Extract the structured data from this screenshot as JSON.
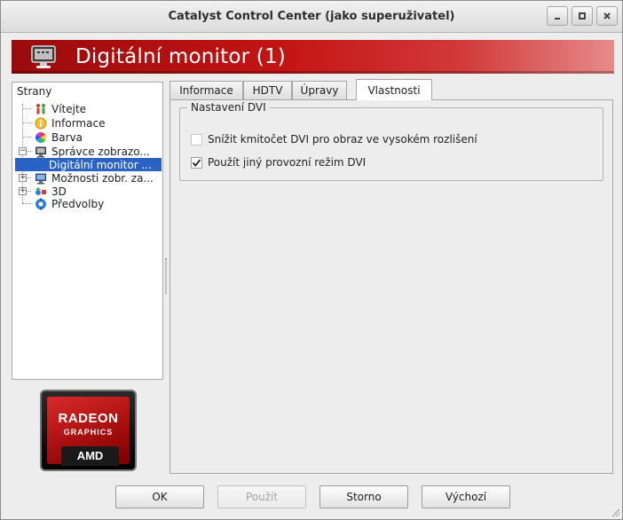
{
  "window": {
    "title": "Catalyst Control Center (jako superuživatel)",
    "controls": {
      "minimize_icon": "minimize-icon",
      "maximize_icon": "maximize-icon",
      "close_icon": "close-icon"
    }
  },
  "banner": {
    "title": "Digitální monitor (1)",
    "icon": "monitor-icon",
    "gradient_colors": [
      "#9a0b0b",
      "#c41414",
      "#e68a8a"
    ]
  },
  "sidebar": {
    "header": "Strany",
    "items": [
      {
        "label": "Vítejte",
        "icon": "welcome-icon"
      },
      {
        "label": "Informace",
        "icon": "info-icon"
      },
      {
        "label": "Barva",
        "icon": "color-wheel-icon"
      },
      {
        "label": "Správce zobrazo...",
        "icon": "display-manager-icon",
        "expanded": true
      },
      {
        "label": "Digitální monitor ...",
        "selected": true
      },
      {
        "label": "Možnosti zobr. za...",
        "icon": "display-options-icon",
        "expanded": false
      },
      {
        "label": "3D",
        "icon": "3d-icon",
        "expanded": false
      },
      {
        "label": "Předvolby",
        "icon": "preferences-icon"
      }
    ]
  },
  "logo": {
    "line1": "RADEON",
    "line2": "GRAPHICS",
    "brand": "AMD"
  },
  "tabs": [
    {
      "label": "Informace"
    },
    {
      "label": "HDTV"
    },
    {
      "label": "Úpravy"
    },
    {
      "label": "Vlastnosti",
      "active": true
    }
  ],
  "dvi_group": {
    "title": "Nastavení DVI",
    "options": [
      {
        "label": "Snížit kmitočet DVI pro obraz ve vysokém rozlišení",
        "checked": false,
        "enabled": false
      },
      {
        "label": "Použít jiný provozní režim DVI",
        "checked": true,
        "enabled": true
      }
    ]
  },
  "buttons": {
    "ok": "OK",
    "apply": "Použít",
    "cancel": "Storno",
    "defaults": "Výchozí"
  },
  "colors": {
    "selection": "#2a63c5",
    "brand_red": "#c41414"
  }
}
